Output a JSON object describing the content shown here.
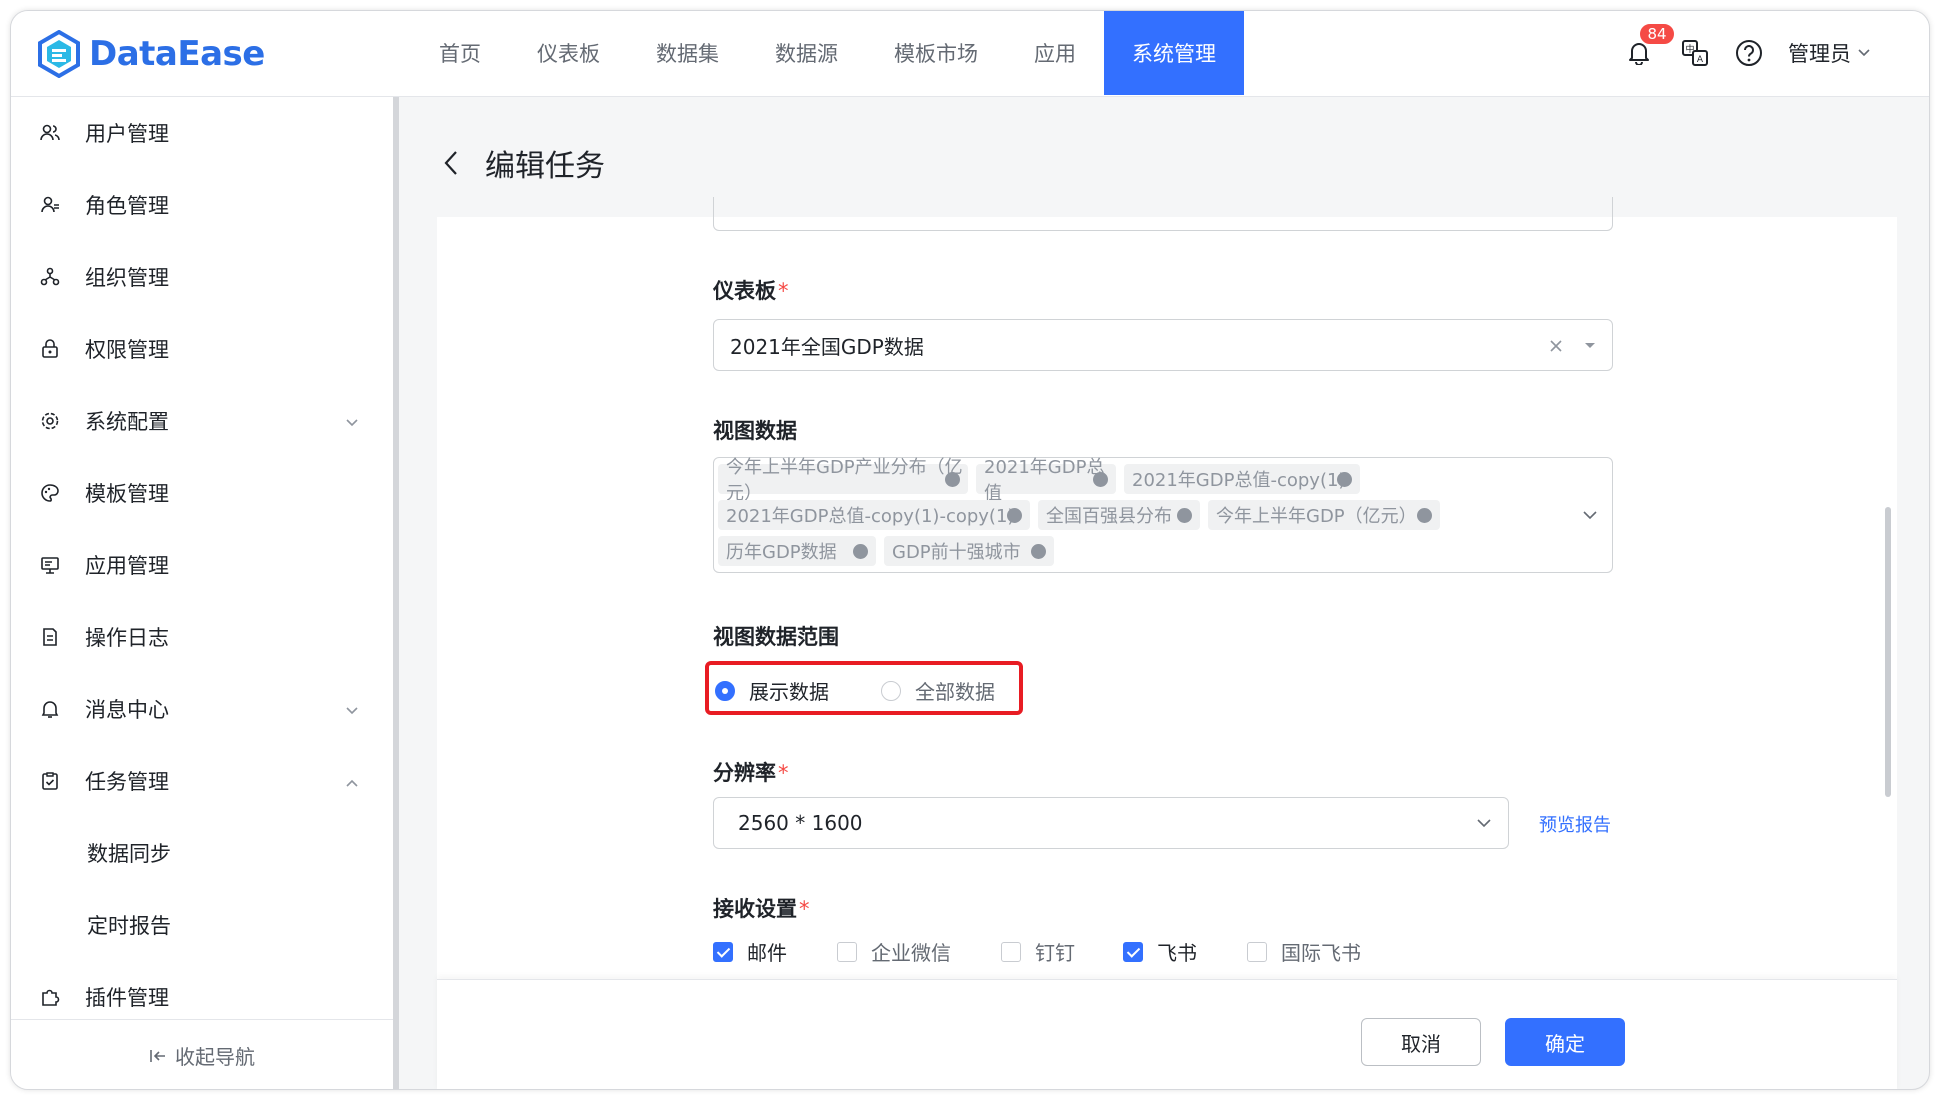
{
  "app": {
    "name": "DataEase"
  },
  "nav": {
    "items": [
      "首页",
      "仪表板",
      "数据集",
      "数据源",
      "模板市场",
      "应用",
      "系统管理"
    ],
    "active_index": 6
  },
  "header": {
    "notification_count": "84",
    "user": "管理员"
  },
  "sidebar": {
    "items": [
      {
        "label": "用户管理",
        "icon": "users-icon"
      },
      {
        "label": "角色管理",
        "icon": "role-icon"
      },
      {
        "label": "组织管理",
        "icon": "org-icon"
      },
      {
        "label": "权限管理",
        "icon": "permission-icon"
      },
      {
        "label": "系统配置",
        "icon": "gear-icon",
        "expand": "down"
      },
      {
        "label": "模板管理",
        "icon": "palette-icon"
      },
      {
        "label": "应用管理",
        "icon": "monitor-icon"
      },
      {
        "label": "操作日志",
        "icon": "log-icon"
      },
      {
        "label": "消息中心",
        "icon": "bell-icon",
        "expand": "down"
      },
      {
        "label": "任务管理",
        "icon": "task-icon",
        "expand": "up"
      },
      {
        "label": "插件管理",
        "icon": "plugin-icon"
      }
    ],
    "sub_items": [
      "数据同步",
      "定时报告"
    ],
    "collapse_label": "收起导航"
  },
  "page": {
    "title": "编辑任务"
  },
  "form": {
    "dashboard": {
      "label": "仪表板",
      "value": "2021年全国GDP数据"
    },
    "views": {
      "label": "视图数据",
      "tags": [
        "今年上半年GDP产业分布（亿元）",
        "2021年GDP总值",
        "2021年GDP总值-copy(1)",
        "2021年GDP总值-copy(1)-copy(1)",
        "全国百强县分布",
        "今年上半年GDP（亿元）",
        "历年GDP数据",
        "GDP前十强城市"
      ]
    },
    "range": {
      "label": "视图数据范围",
      "options": [
        "展示数据",
        "全部数据"
      ],
      "selected": 0
    },
    "resolution": {
      "label": "分辨率",
      "value": "2560 * 1600",
      "preview_link": "预览报告"
    },
    "receivers": {
      "label": "接收设置",
      "options": [
        {
          "label": "邮件",
          "checked": true
        },
        {
          "label": "企业微信",
          "checked": false
        },
        {
          "label": "钉钉",
          "checked": false
        },
        {
          "label": "飞书",
          "checked": true
        },
        {
          "label": "国际飞书",
          "checked": false
        }
      ]
    }
  },
  "footer": {
    "cancel": "取消",
    "confirm": "确定"
  },
  "colors": {
    "primary": "#3370ff",
    "highlight_border": "#e81c23",
    "required": "#f54a45"
  }
}
